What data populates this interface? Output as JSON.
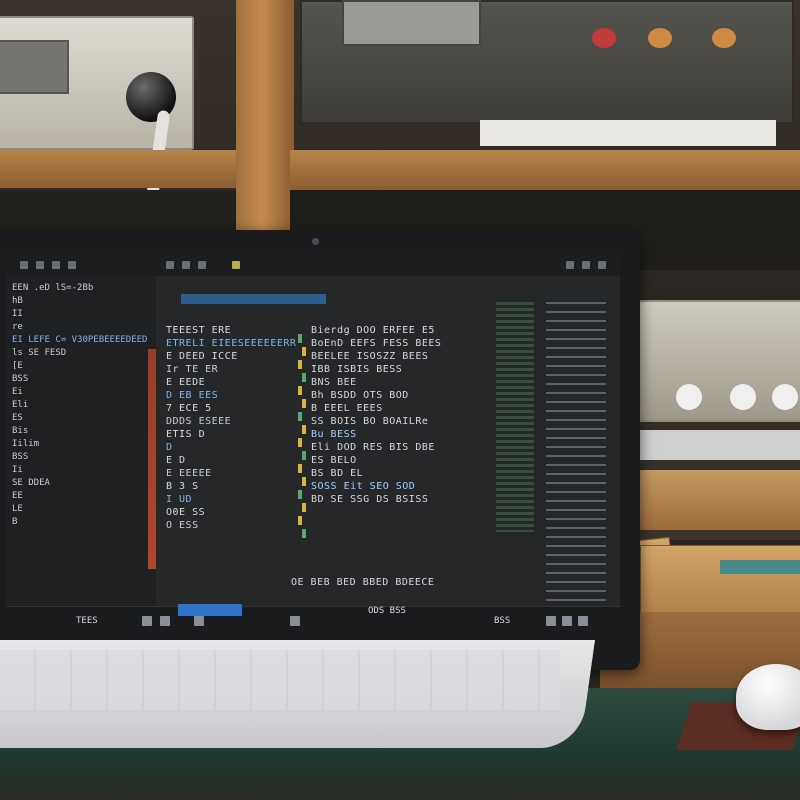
{
  "scene": {
    "description_free": true,
    "colors": {
      "screen_bg": "#232426",
      "sidebar_bg": "#1f2022",
      "selection": "#2d5e8f",
      "keyword": "#d7b43d",
      "string": "#5ba86a",
      "desk": "#2f4a3f",
      "wood": "#c58a4e"
    }
  },
  "laptop": {
    "screen": {
      "sidebar_lines": [
        "EEN .eD lS=-2Bb",
        "hB",
        "II",
        "re",
        "EI LEFE C= V30PEBEEEEDEED",
        "ls SE FESD",
        "[E",
        "BSS",
        "Ei",
        "Eli",
        "ES",
        "Bis",
        "Iilim",
        "BSS",
        "Ii",
        "SE DDEA",
        "EE",
        "LE",
        "B"
      ],
      "editor_lines": [
        "TEEEST ERE",
        "ETRELI EIEESEEEEEERR",
        "E DEED ICCE",
        "Ir TE ER",
        "E EEDE",
        "D EB EES",
        "7 ECE 5",
        "DDDS ESEEE",
        "ETIS D",
        "D",
        "E D",
        "E EEEEE",
        "B 3 S",
        "I UD",
        "O0E SS",
        "O ESS"
      ],
      "right_code_lines": [
        "Bierdg DOO ERFEE E5",
        "BoEnD EEFS FESS BEES",
        "BEELEE ISOSZZ BEES",
        "IBB ISBIS BESS",
        "BNS BEE",
        "Bh BSDD OTS BOD",
        "B EEEL EEES",
        "SS BOIS BO BOAILRe",
        "Bu BESS",
        "Eli DOD RES BIS DBE",
        "ES BELO",
        "BS BD EL",
        "SOSS Eit SEO SOD",
        "BD SE SSG DS BSISS"
      ],
      "footer_text": "OE BEB BED BBED BDEECE",
      "status_left": "TEES",
      "status_center": "ODS BSS",
      "status_right": "BSS"
    }
  }
}
